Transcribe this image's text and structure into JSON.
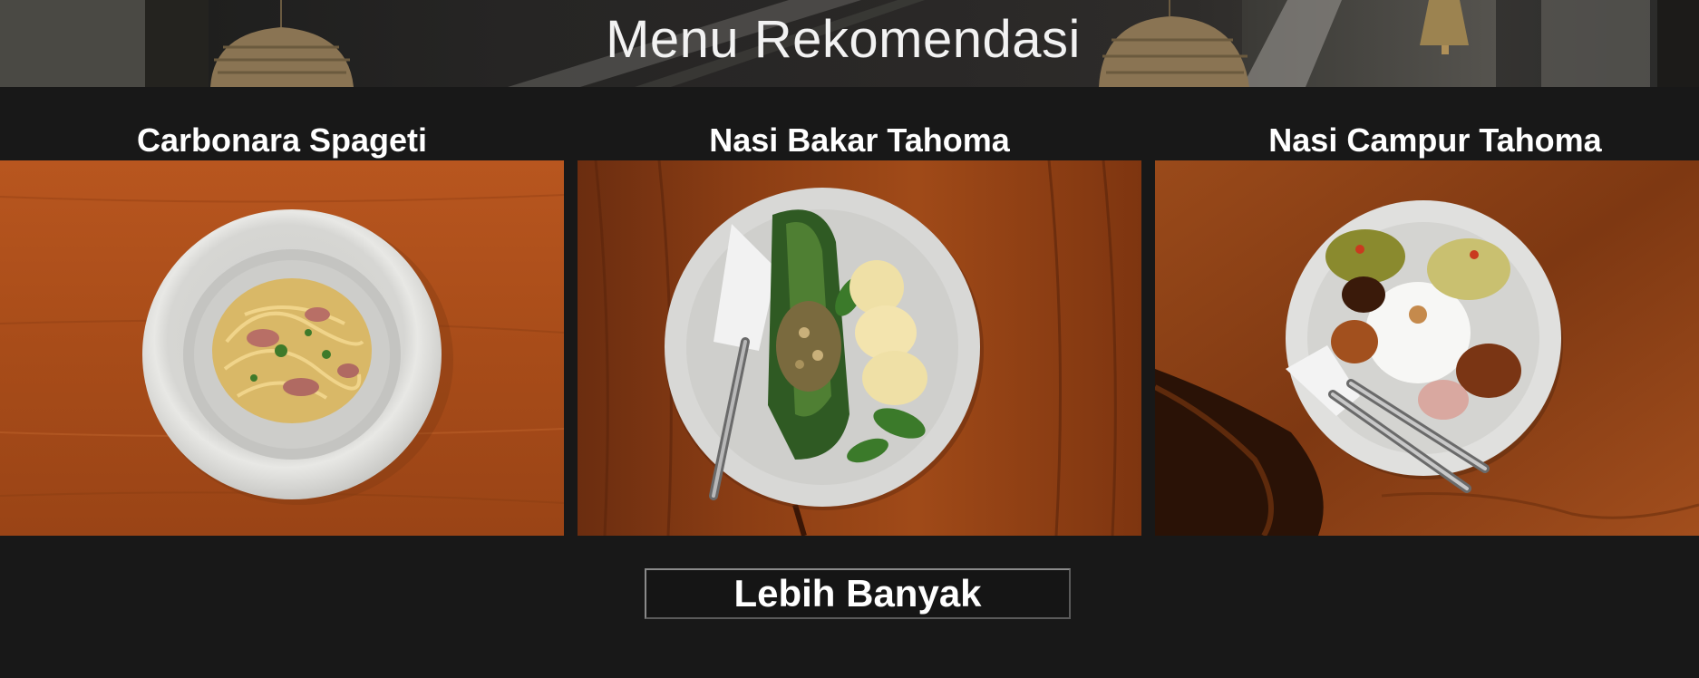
{
  "header": {
    "title": "Menu Rekomendasi"
  },
  "menu": [
    {
      "name": "Carbonara Spageti",
      "image": "carbonara-spaghetti-photo"
    },
    {
      "name": "Nasi Bakar Tahoma",
      "image": "nasi-bakar-photo"
    },
    {
      "name": "Nasi Campur Tahoma",
      "image": "nasi-campur-photo"
    }
  ],
  "more_button": {
    "label": "Lebih Banyak"
  },
  "colors": {
    "background": "#181818",
    "text": "#ffffff",
    "wood": "#a8501e"
  }
}
